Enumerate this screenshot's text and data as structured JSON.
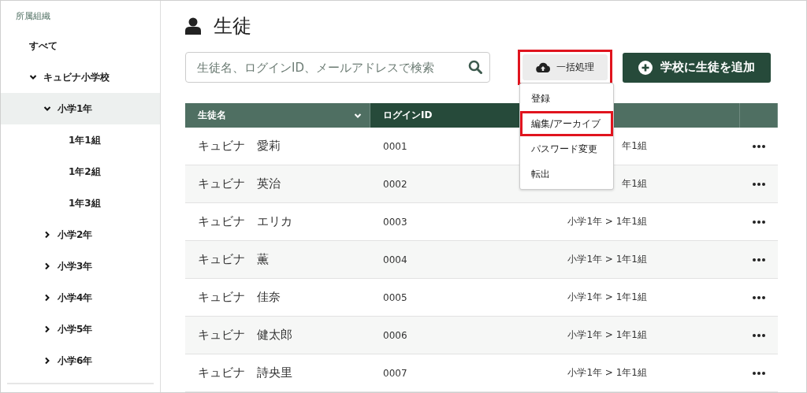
{
  "sidebar": {
    "heading": "所属組織",
    "items": [
      {
        "label": "すべて",
        "selected": false
      },
      {
        "label": "キュビナ小学校",
        "selected": false,
        "expanded": true,
        "children": [
          {
            "label": "小学1年",
            "selected": true,
            "expanded": true,
            "children": [
              {
                "label": "1年1組",
                "selected": false
              },
              {
                "label": "1年2組",
                "selected": false
              },
              {
                "label": "1年3組",
                "selected": false
              }
            ]
          },
          {
            "label": "小学2年",
            "selected": false,
            "expanded": false
          },
          {
            "label": "小学3年",
            "selected": false,
            "expanded": false
          },
          {
            "label": "小学4年",
            "selected": false,
            "expanded": false
          },
          {
            "label": "小学5年",
            "selected": false,
            "expanded": false
          },
          {
            "label": "小学6年",
            "selected": false,
            "expanded": false
          }
        ]
      }
    ]
  },
  "page_title": "生徒",
  "search": {
    "placeholder": "生徒名、ログインID、メールアドレスで検索"
  },
  "bulk_button": {
    "label": "一括処理",
    "highlighted": true,
    "expanded": true,
    "menu": [
      {
        "label": "登録",
        "highlighted": false
      },
      {
        "label": "編集/アーカイブ",
        "highlighted": true
      },
      {
        "label": "パスワード変更",
        "highlighted": false
      },
      {
        "label": "転出",
        "highlighted": false
      }
    ]
  },
  "add_button": {
    "label": "学校に生徒を追加"
  },
  "table": {
    "columns": [
      {
        "label": "生徒名",
        "sortable": true,
        "highlighted": false
      },
      {
        "label": "ログインID",
        "sortable": false,
        "highlighted": true
      },
      {
        "highlighted": false
      },
      {
        "highlighted": false
      }
    ],
    "rows": [
      {
        "name": "キュビナ　愛莉",
        "login_id": "0001",
        "class": "年1組"
      },
      {
        "name": "キュビナ　英治",
        "login_id": "0002",
        "class": "年1組"
      },
      {
        "name": "キュビナ　エリカ",
        "login_id": "0003",
        "class": "小学1年 > 1年1組"
      },
      {
        "name": "キュビナ　薫",
        "login_id": "0004",
        "class": "小学1年 > 1年1組"
      },
      {
        "name": "キュビナ　佳奈",
        "login_id": "0005",
        "class": "小学1年 > 1年1組"
      },
      {
        "name": "キュビナ　健太郎",
        "login_id": "0006",
        "class": "小学1年 > 1年1組"
      },
      {
        "name": "キュビナ　詩央里",
        "login_id": "0007",
        "class": "小学1年 > 1年1組"
      }
    ]
  }
}
